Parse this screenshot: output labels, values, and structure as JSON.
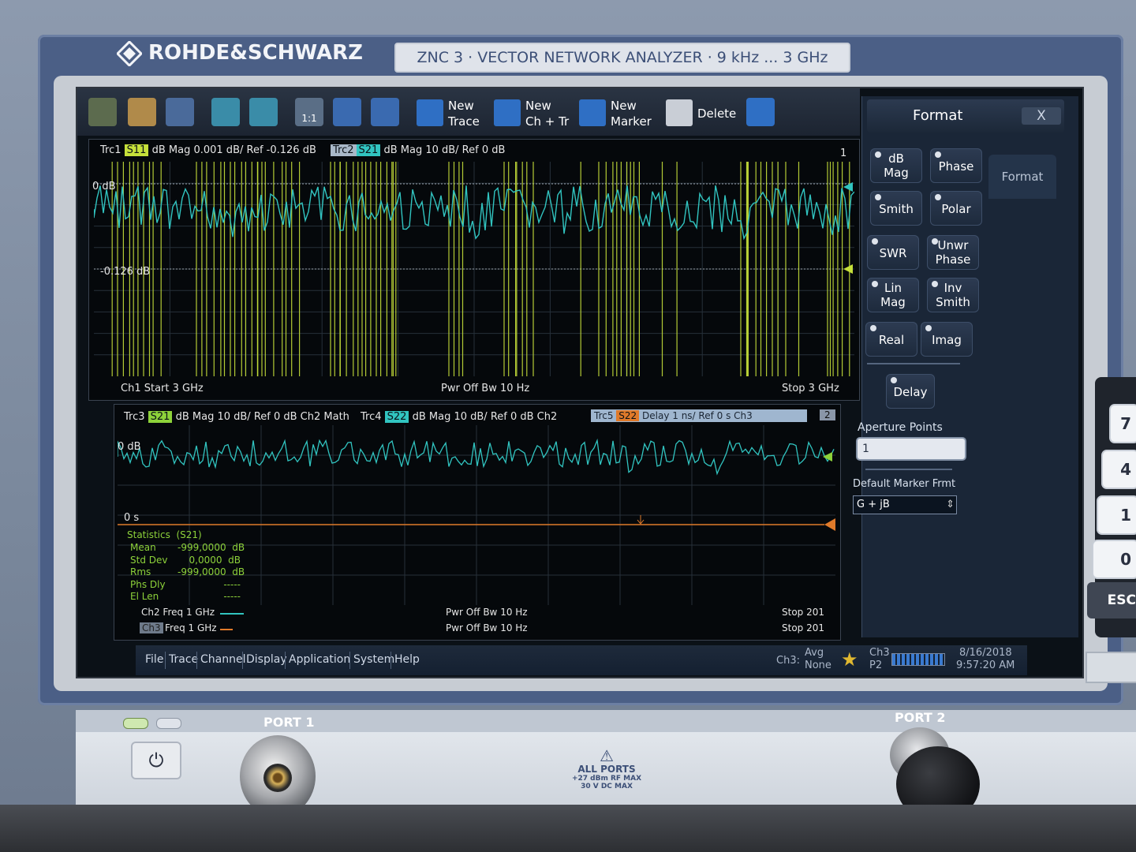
{
  "instrument": {
    "brand": "ROHDE&SCHWARZ",
    "model_plate": "ZNC 3  ·  VECTOR NETWORK ANALYZER  ·  9 kHz ... 3 GHz"
  },
  "toolbar": {
    "new_trace": "New\nTrace",
    "new_ch_tr": "New\nCh + Tr",
    "new_marker": "New\nMarker",
    "delete": "Delete",
    "zoom_1to1": "1:1"
  },
  "diagram1": {
    "trc1_label": "Trc1",
    "trc1_param": "S11",
    "trc1_info": "dB Mag  0.001 dB/ Ref -0.126 dB",
    "trc2_label": "Trc2",
    "trc2_param": "S21",
    "trc2_info": "dB Mag  10 dB/ Ref 0 dB",
    "number": "1",
    "ref0": "0 dB",
    "ref1": "-0.126 dB",
    "foot_left": "Ch1  Start  3 GHz",
    "foot_mid": "Pwr  Off  Bw  10 Hz",
    "foot_right": "Stop  3 GHz",
    "colors": {
      "trc1": "#c6e03a",
      "trc2": "#31c4c0"
    }
  },
  "diagram2": {
    "trc3_label": "Trc3",
    "trc3_param": "S21",
    "trc3_info": "dB Mag  10 dB/ Ref 0 dB  Ch2  Math",
    "trc4_label": "Trc4",
    "trc4_param": "S22",
    "trc4_info": "dB Mag  10 dB/ Ref 0 dB  Ch2",
    "trc5_label": "Trc5",
    "trc5_param": "S22",
    "trc5_info": "Delay     1 ns/ Ref 0 s      Ch3",
    "number": "2",
    "ref0": "0 dB",
    "ref_s": "0 s",
    "stats": {
      "title": "Statistics  (S21)",
      "rows": [
        [
          "Mean",
          "-999,0000  dB"
        ],
        [
          "Std Dev",
          "0,0000  dB"
        ],
        [
          "Rms",
          "-999,0000  dB"
        ],
        [
          "Phs Dly",
          "-----"
        ],
        [
          "El Len",
          "-----"
        ]
      ]
    },
    "foot_ch2": "Ch2  Freq  1 GHz",
    "foot_ch3_tag": "Ch3",
    "foot_ch3": "Freq  1 GHz",
    "foot_mid": "Pwr  Off  Bw  10 Hz",
    "foot_right": "Stop  201",
    "colors": {
      "trc5": "#e07a2a"
    }
  },
  "menubar": {
    "items": [
      "File",
      "Trace",
      "Channel",
      "Display",
      "Application",
      "System",
      "Help"
    ]
  },
  "status": {
    "ch": "Ch3:",
    "avg": "Avg\nNone",
    "ch3": "Ch3\nP2",
    "date": "8/16/2018",
    "time": "9:57:20 AM"
  },
  "panel": {
    "title": "Format",
    "close": "X",
    "tab": "Format",
    "keys": [
      "dB\nMag",
      "Phase",
      "Smith",
      "Polar",
      "SWR",
      "Unwr\nPhase",
      "Lin\nMag",
      "Inv\nSmith",
      "Real",
      "Imag"
    ],
    "delay": "Delay",
    "aperture_label": "Aperture Points",
    "aperture_value": "1",
    "marker_label": "Default Marker Frmt",
    "marker_value": "G + jB"
  },
  "front": {
    "port1": "PORT 1",
    "port2": "PORT 2",
    "warn_title": "ALL PORTS",
    "warn_1": "+27 dBm RF MAX",
    "warn_2": "30 V DC MAX",
    "keys": [
      "7",
      "4",
      "1",
      "0"
    ],
    "esc": "ESC"
  }
}
